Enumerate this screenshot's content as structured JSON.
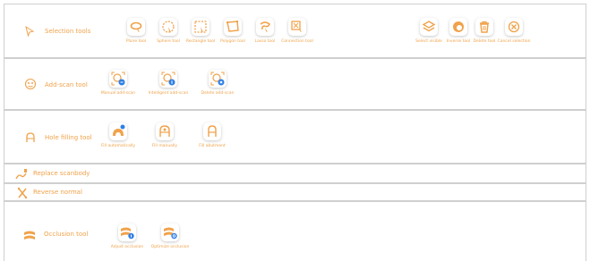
{
  "accent": "#f0a24a",
  "sections": {
    "selection": {
      "title": "Selection tools",
      "tools": [
        "Plane tool",
        "Sphere tool",
        "Rectangle tool",
        "Polygon tool",
        "Lasso tool",
        "Connection tool"
      ],
      "right_tools": [
        "Select visible",
        "Inverse tool",
        "Delete tool",
        "Cancel selection"
      ]
    },
    "add_scan": {
      "title": "Add-scan tool",
      "tools": [
        "Manual add-scan",
        "Intelligent add-scan",
        "Delete add-scan"
      ]
    },
    "hole": {
      "title": "Hole filling tool",
      "tools": [
        "Fill automatically",
        "Fill manually",
        "Fill abutment"
      ]
    },
    "replace": {
      "title": "Replace scanbody"
    },
    "reverse": {
      "title": "Reverse normal"
    },
    "occlusion": {
      "title": "Occlusion tool",
      "tools": [
        "Adjust occlusion",
        "Optimize occlusion"
      ]
    }
  }
}
